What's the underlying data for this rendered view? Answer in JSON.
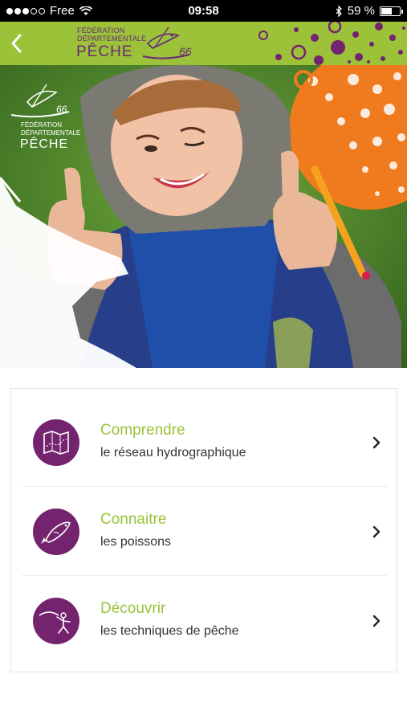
{
  "status_bar": {
    "carrier": "Free",
    "time": "09:58",
    "battery_text": "59 %",
    "battery_level": 0.59
  },
  "header": {
    "logo_line1": "FÉDÉRATION",
    "logo_line2": "DÉPARTEMENTALE",
    "logo_line3": "PÊCHE",
    "logo_number": "66",
    "back_icon": "chevron-left-icon"
  },
  "hero": {
    "logo_line1": "FÉDÉRATION",
    "logo_line2": "DÉPARTEMENTALE",
    "logo_line3": "PÊCHE",
    "logo_number": "66"
  },
  "menu": {
    "items": [
      {
        "title": "Comprendre",
        "subtitle": "le réseau hydrographique",
        "icon": "map-icon"
      },
      {
        "title": "Connaitre",
        "subtitle": "les poissons",
        "icon": "fish-icon"
      },
      {
        "title": "Découvrir",
        "subtitle": "les techniques de pêche",
        "icon": "fisherman-icon"
      }
    ]
  },
  "colors": {
    "brand_green": "#9bc238",
    "brand_purple": "#74236f",
    "accent_orange": "#f07a1e"
  }
}
